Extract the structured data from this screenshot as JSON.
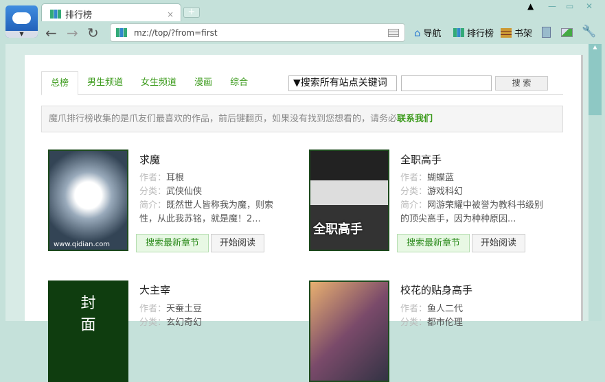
{
  "browser": {
    "tab_title": "排行榜",
    "tab_close": "×",
    "new_tab": "+",
    "address": "mz://top/?from=first",
    "bookmarks": [
      {
        "label": "导航",
        "icon": "home-icon"
      },
      {
        "label": "排行榜",
        "icon": "chart-icon"
      },
      {
        "label": "书架",
        "icon": "bookshelf-icon"
      }
    ],
    "window_buttons": [
      "pin",
      "minimize",
      "maximize",
      "close"
    ]
  },
  "page": {
    "tabs": [
      "总榜",
      "男生频道",
      "女生频道",
      "漫画",
      "综合"
    ],
    "search_scope": "▼搜索所有站点关键词",
    "search_value": "",
    "search_button": "搜 索",
    "notice_text": "魔爪排行榜收集的是爪友们最喜欢的作品，前后键翻页，如果没有找到您想看的，请务必",
    "notice_link": "联系我们",
    "labels": {
      "author": "作者：",
      "category": "分类：",
      "intro": "简介："
    },
    "buttons": {
      "search_chapter": "搜索最新章节",
      "start_read": "开始阅读"
    },
    "books": [
      {
        "title": "求魔",
        "author": "耳根",
        "category": "武侠仙侠",
        "intro": "既然世人皆称我为魔，则索性，从此我苏铭，就是魔！2...",
        "cover_text": "www.qidian.com"
      },
      {
        "title": "全职高手",
        "author": "蝴蝶蓝",
        "category": "游戏科幻",
        "intro": "网游荣耀中被誉为教科书级别的顶尖高手，因为种种原因...",
        "cover_text": "全职高手"
      },
      {
        "title": "大主宰",
        "author": "天蚕土豆",
        "category": "玄幻奇幻",
        "cover_text": "封面"
      },
      {
        "title": "校花的贴身高手",
        "author": "鱼人二代",
        "category": "都市伦理"
      }
    ]
  }
}
